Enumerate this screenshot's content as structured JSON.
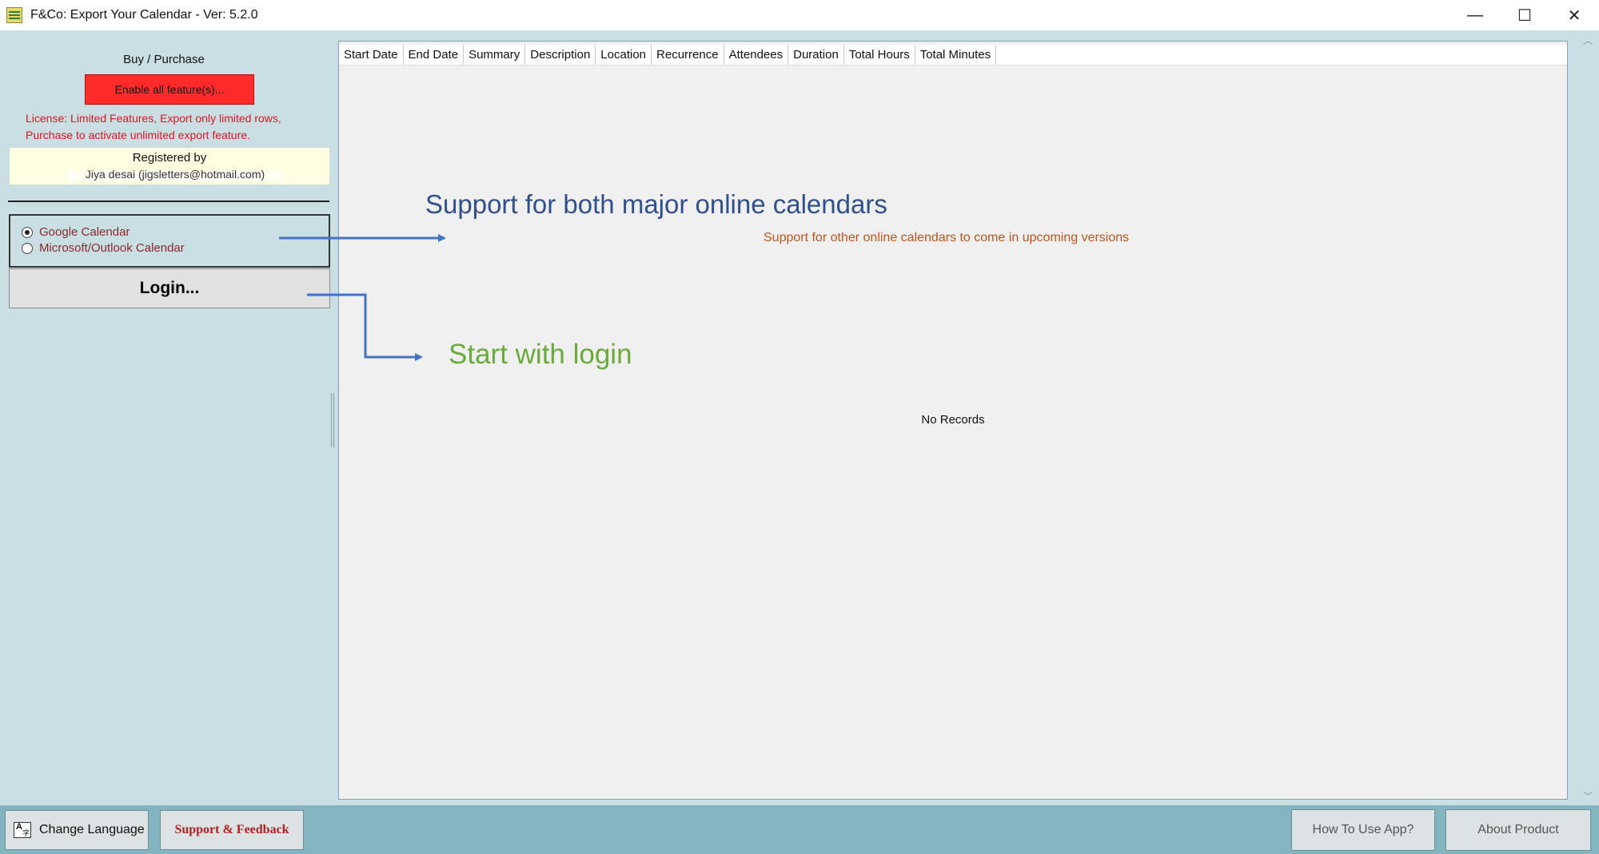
{
  "window": {
    "title": "F&Co: Export Your Calendar - Ver: 5.2.0",
    "controls": {
      "minimize": "—",
      "maximize": "☐",
      "close": "✕"
    }
  },
  "left_panel": {
    "buy_label": "Buy / Purchase",
    "enable_button": "Enable all feature(s)...",
    "license_line1": "License: Limited Features, Export only limited rows,",
    "license_line2": "Purchase to activate unlimited export feature.",
    "registered_label": "Registered by",
    "registered_value": "Jiya desai (jigsletters@hotmail.com)",
    "calendar_options": [
      {
        "label": "Google Calendar",
        "selected": true
      },
      {
        "label": "Microsoft/Outlook Calendar",
        "selected": false
      }
    ],
    "login_button": "Login..."
  },
  "grid": {
    "columns": [
      "Start Date",
      "End Date",
      "Summary",
      "Description",
      "Location",
      "Recurrence",
      "Attendees",
      "Duration",
      "Total Hours",
      "Total Minutes"
    ],
    "empty_message": "No Records"
  },
  "annotations": {
    "major": "Support for both major online calendars",
    "other": "Support for other online calendars to come in upcoming versions",
    "login": "Start with login",
    "colors": {
      "major": "#2f4f8f",
      "other": "#c0561c",
      "login": "#6aab3a",
      "arrow": "#4472c4"
    }
  },
  "bottom_bar": {
    "change_language": "Change Language",
    "support_feedback": "Support & Feedback",
    "how_to_use": "How To Use App?",
    "about_product": "About Product"
  }
}
